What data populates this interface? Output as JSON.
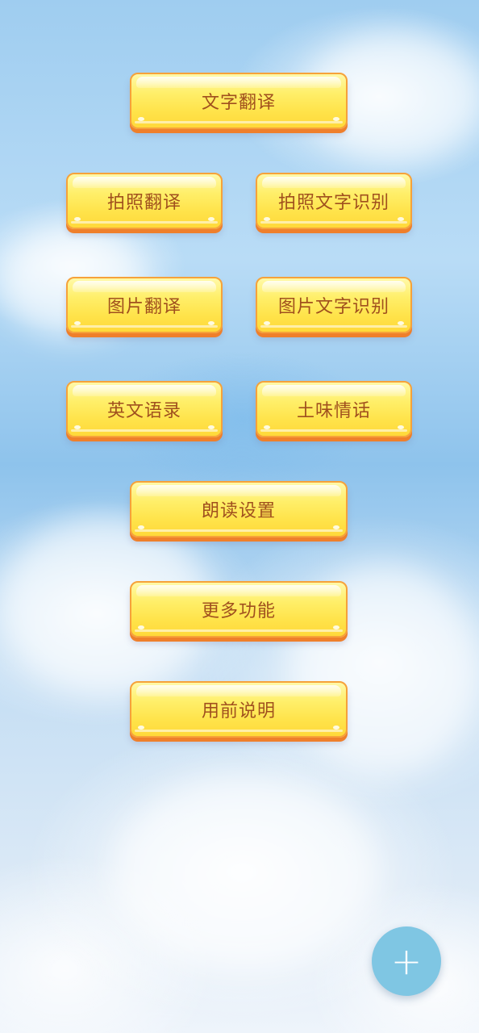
{
  "buttons": {
    "text_translate": "文字翻译",
    "photo_translate": "拍照翻译",
    "photo_text_recognition": "拍照文字识别",
    "image_translate": "图片翻译",
    "image_text_recognition": "图片文字识别",
    "english_quotes": "英文语录",
    "cheesy_love_lines": "土味情话",
    "read_aloud_settings": "朗读设置",
    "more_features": "更多功能",
    "instructions": "用前说明"
  },
  "fab": {
    "icon": "plus-icon",
    "glyph": "+",
    "color": "#7fc6e3"
  },
  "colors": {
    "button_fill": "#ffe34a",
    "button_border": "#f6a23a",
    "button_text": "#a0501e",
    "sky": "#9fcdf0"
  }
}
